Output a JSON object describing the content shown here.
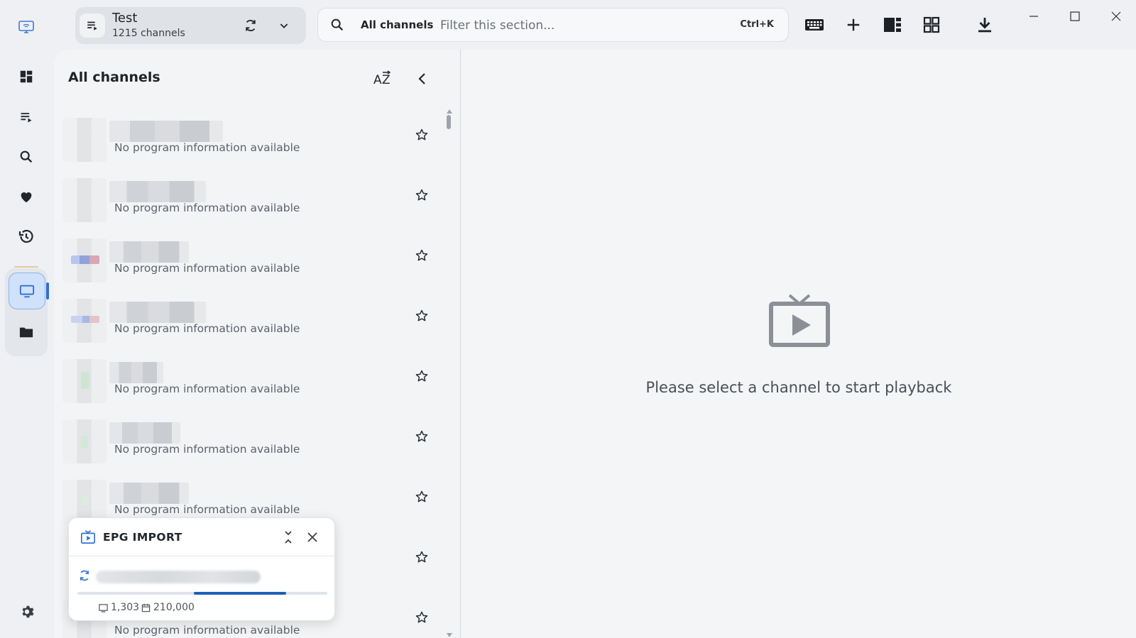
{
  "playlist": {
    "title": "Test",
    "subtitle": "1215 channels"
  },
  "search": {
    "scope": "All channels",
    "placeholder": "Filter this section...",
    "shortcut": "Ctrl+K"
  },
  "toolbar": {
    "icons": [
      "keyboard-icon",
      "add-icon",
      "split-view-icon",
      "grid-view-icon",
      "download-icon"
    ]
  },
  "window_controls": [
    "minimize-icon",
    "maximize-icon",
    "close-icon"
  ],
  "nav": {
    "items": [
      "dashboard-icon",
      "playlist-icon",
      "search-icon",
      "favorites-icon",
      "history-icon",
      "live-tv-icon",
      "folder-icon"
    ],
    "active": "live-tv-icon",
    "bottom": "settings-icon"
  },
  "list": {
    "title": "All channels",
    "sort_icon": "sort-az-icon",
    "collapse_icon": "chevron-left-icon",
    "channels": [
      {
        "program": "No program information available"
      },
      {
        "program": "No program information available"
      },
      {
        "program": "No program information available"
      },
      {
        "program": "No program information available"
      },
      {
        "program": "No program information available"
      },
      {
        "program": "No program information available"
      },
      {
        "program": "No program information available"
      },
      {
        "program": ""
      },
      {
        "program": "No program information available"
      }
    ]
  },
  "playback": {
    "message": "Please select a channel to start playback"
  },
  "epg_import": {
    "title": "EPG IMPORT",
    "progress": 0.37,
    "channels_count": "1,303",
    "programs_count": "210,000"
  },
  "colors": {
    "accent": "#2f6fd1",
    "progress": "#1f5fb5"
  }
}
